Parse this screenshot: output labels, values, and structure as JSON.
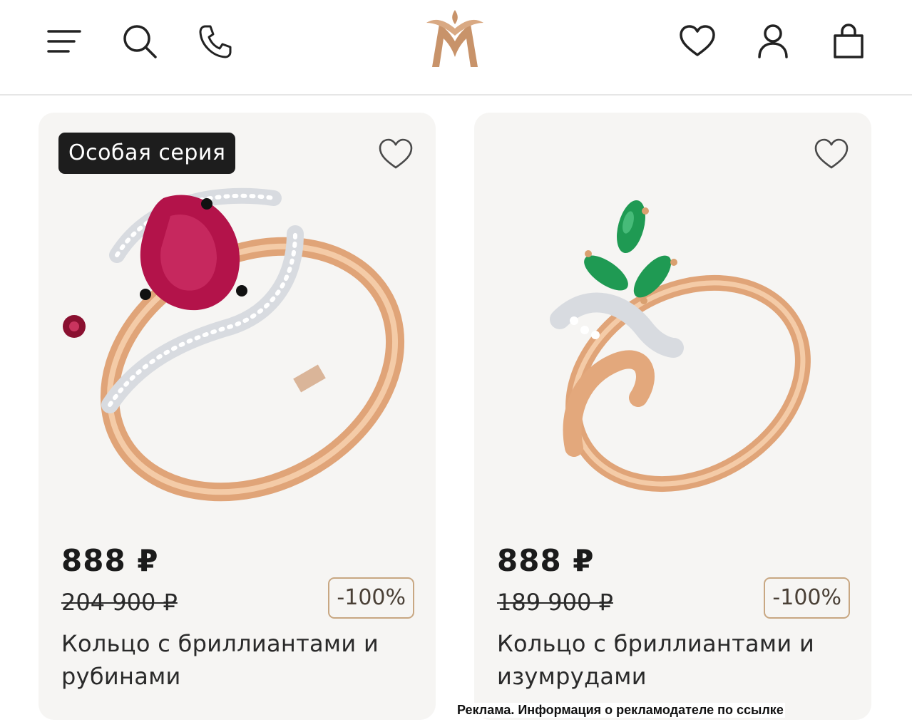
{
  "header": {
    "menu_icon": "menu-icon",
    "search_icon": "search-icon",
    "phone_icon": "phone-icon",
    "logo_icon": "brand-logo",
    "favorites_icon": "heart-icon",
    "account_icon": "user-icon",
    "cart_icon": "shopping-bag-icon"
  },
  "colors": {
    "accent_gold": "#c8936a",
    "badge_bg": "#1d1d1d",
    "card_bg": "#f6f5f3",
    "discount_border": "#c8a782"
  },
  "products": [
    {
      "badge": "Особая серия",
      "price": "888 ₽",
      "old_price": "204 900 ₽",
      "discount": "-100%",
      "title": "Кольцо с бриллиантами и рубинами",
      "favorite_icon": "heart-outline-icon"
    },
    {
      "price": "888 ₽",
      "old_price": "189 900 ₽",
      "discount": "-100%",
      "title": "Кольцо с бриллиантами и изумрудами",
      "favorite_icon": "heart-outline-icon"
    }
  ],
  "ad_note": "Реклама. Информация о рекламодателе по ссылке"
}
